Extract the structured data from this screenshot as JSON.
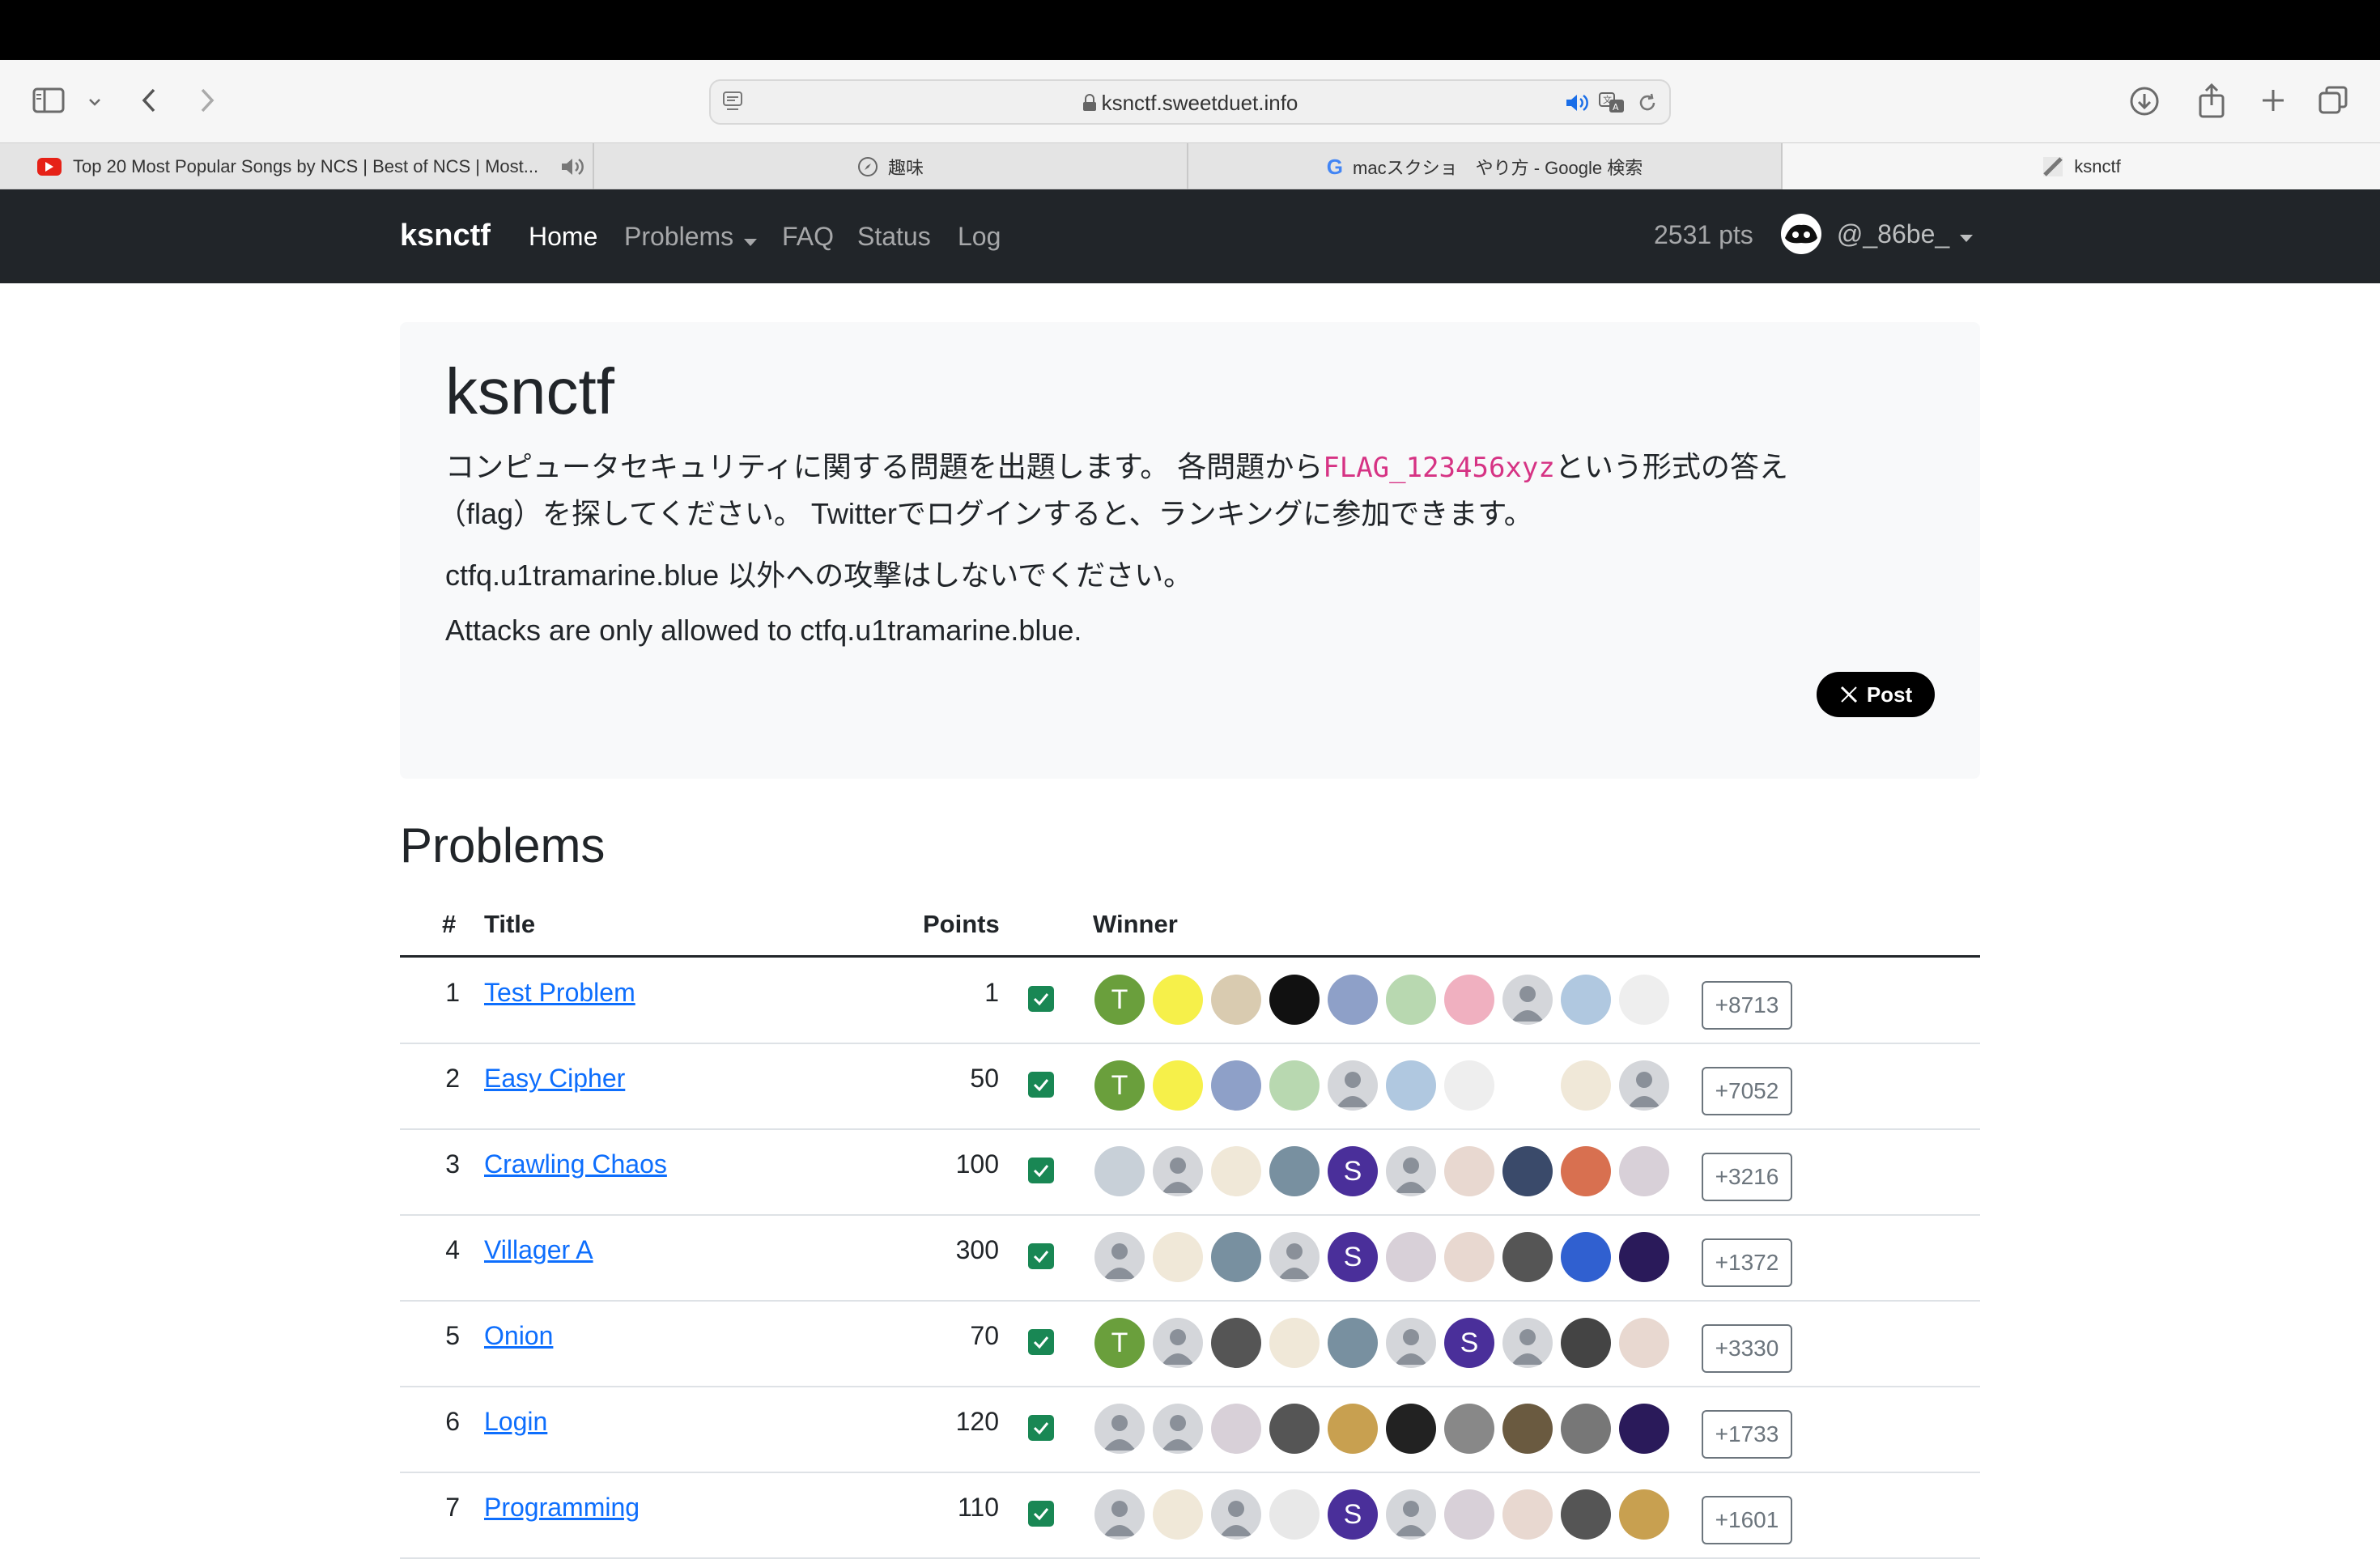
{
  "browser": {
    "url": "ksnctf.sweetduet.info",
    "tabs": [
      {
        "label": "Top 20 Most Popular Songs by NCS | Best of NCS | Most..."
      },
      {
        "label": "趣味"
      },
      {
        "label": "macスクショ　やり方 - Google 検索"
      },
      {
        "label": "ksnctf"
      }
    ]
  },
  "navbar": {
    "brand": "ksnctf",
    "links": [
      "Home",
      "Problems",
      "FAQ",
      "Status",
      "Log"
    ],
    "points": "2531 pts",
    "user": "@_86be_"
  },
  "jumbotron": {
    "title": "ksnctf",
    "line1_a": "コンピュータセキュリティに関する問題を出題します。 各問題から",
    "line1_code": "FLAG_123456xyz",
    "line1_b": "という形式の答え",
    "line2": "（flag）を探してください。 Twitterでログインすると、ランキングに参加できます。",
    "line3": "ctfq.u1tramarine.blue 以外への攻撃はしないでください。",
    "line4": "Attacks are only allowed to ctfq.u1tramarine.blue.",
    "post_label": "Post"
  },
  "problems": {
    "heading": "Problems",
    "headers": {
      "num": "#",
      "title": "Title",
      "points": "Points",
      "winner": "Winner"
    },
    "rows": [
      {
        "num": "1",
        "title": "Test Problem",
        "points": "1",
        "more": "+8713"
      },
      {
        "num": "2",
        "title": "Easy Cipher",
        "points": "50",
        "more": "+7052"
      },
      {
        "num": "3",
        "title": "Crawling Chaos",
        "points": "100",
        "more": "+3216"
      },
      {
        "num": "4",
        "title": "Villager A",
        "points": "300",
        "more": "+1372"
      },
      {
        "num": "5",
        "title": "Onion",
        "points": "70",
        "more": "+3330"
      },
      {
        "num": "6",
        "title": "Login",
        "points": "120",
        "more": "+1733"
      },
      {
        "num": "7",
        "title": "Programming",
        "points": "110",
        "more": "+1601"
      }
    ]
  },
  "colors": {
    "navbar_bg": "#212529",
    "link": "#0d6efd",
    "check": "#198754",
    "code": "#d63384"
  }
}
